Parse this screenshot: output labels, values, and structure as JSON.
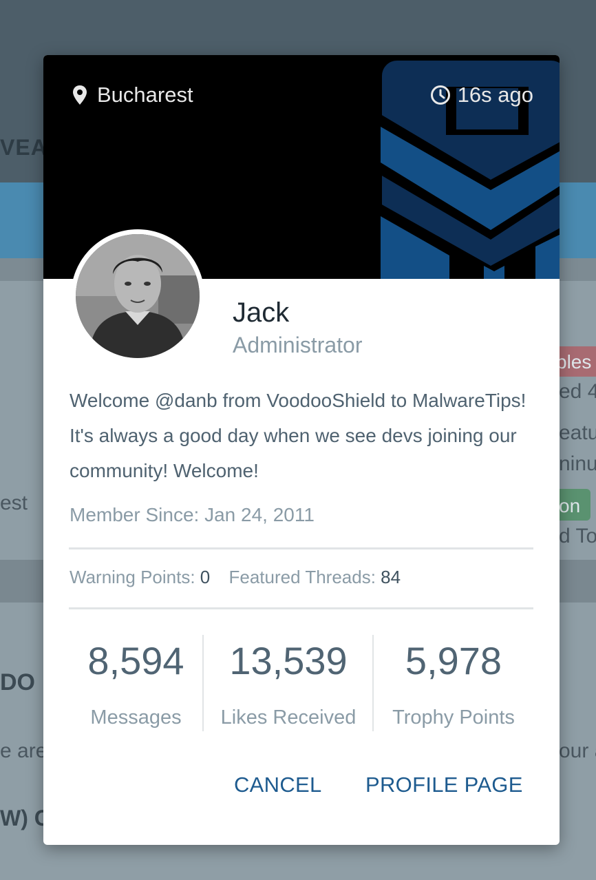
{
  "background": {
    "nav_fragment": "VEAV",
    "right_badge_1": "bles",
    "right_text_1": "ed 4",
    "right_text_2": "eatu",
    "right_text_3": "ninu",
    "right_badge_2": "on",
    "right_text_4": "d To",
    "left_text_1": "est",
    "left_text_2": "DO",
    "left_text_3": "e are",
    "left_text_4": "W) C",
    "right_text_5": "our a"
  },
  "card": {
    "location": "Bucharest",
    "last_seen": "16s ago",
    "name": "Jack",
    "role": "Administrator",
    "bio": "Welcome @danb from VoodooShield to MalwareTips! It's always a good day when we see devs joining our community! Welcome!",
    "member_since": "Member Since: Jan 24, 2011",
    "warning_points_label": "Warning Points:",
    "warning_points_value": "0",
    "featured_threads_label": "Featured Threads:",
    "featured_threads_value": "84",
    "stats": [
      {
        "value": "8,594",
        "label": "Messages"
      },
      {
        "value": "13,539",
        "label": "Likes Received"
      },
      {
        "value": "5,978",
        "label": "Trophy Points"
      }
    ],
    "cancel_label": "CANCEL",
    "profile_label": "PROFILE PAGE",
    "icons": {
      "location": "map-pin-icon",
      "time": "clock-icon"
    },
    "colors": {
      "link": "#1e5b8f",
      "muted": "#8a9ba6",
      "text": "#4f6270",
      "banner": "#000000",
      "logo_blue": "#134f86"
    }
  }
}
